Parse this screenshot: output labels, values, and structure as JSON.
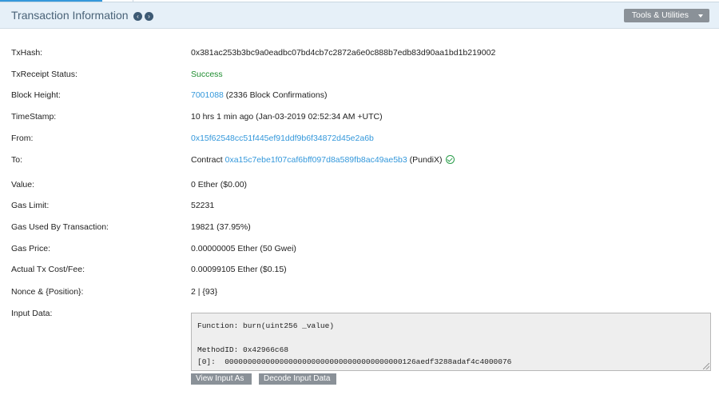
{
  "header": {
    "title": "Transaction Information",
    "prev_icon": "chevron-left-circle-icon",
    "next_icon": "chevron-right-circle-icon",
    "tools_label": "Tools & Utilities"
  },
  "rows": [
    {
      "label": "TxHash:",
      "value": "0x381ac253b3bc9a0eadbc07bd4cb7c2872a6e0c888b7edb83d90aa1bd1b219002"
    },
    {
      "label": "TxReceipt Status:",
      "value": "Success"
    },
    {
      "label": "Block Height:",
      "link": "7001088",
      "value": " (2336 Block Confirmations)"
    },
    {
      "label": "TimeStamp:",
      "value": "10 hrs 1 min ago (Jan-03-2019 02:52:34 AM +UTC)"
    },
    {
      "label": "From:",
      "link": "0x15f62548cc51f445ef91ddf9b6f34872d45e2a6b"
    },
    {
      "label": "To:",
      "prefix": "Contract ",
      "link": "0xa15c7ebe1f07caf6bff097d8a589fb8ac49ae5b3",
      "suffix": " (PundiX)"
    },
    {
      "label": "Value:",
      "value": "0 Ether ($0.00)"
    },
    {
      "label": "Gas Limit:",
      "value": "52231"
    },
    {
      "label": "Gas Used By Transaction:",
      "value": "19821 (37.95%)"
    },
    {
      "label": "Gas Price:",
      "value": "0.00000005 Ether (50 Gwei)"
    },
    {
      "label": "Actual Tx Cost/Fee:",
      "value": "0.00099105 Ether ($0.15)"
    },
    {
      "label": "Nonce & {Position}:",
      "value": "2 | {93}"
    },
    {
      "label": "Input Data:"
    }
  ],
  "input_data": {
    "function_line": "Function: burn(uint256 _value)",
    "method_line": "MethodID: 0x42966c68",
    "param_line": "[0]:  000000000000000000000000000000000000000126aedf3288adaf4c4000076"
  },
  "buttons": {
    "view_input_label": "View Input As",
    "decode_label": "Decode Input Data"
  },
  "colors": {
    "link": "#3498db",
    "success": "#1e8d2f",
    "header_bg": "#e6f0f8",
    "button_bg": "#8a9198"
  }
}
